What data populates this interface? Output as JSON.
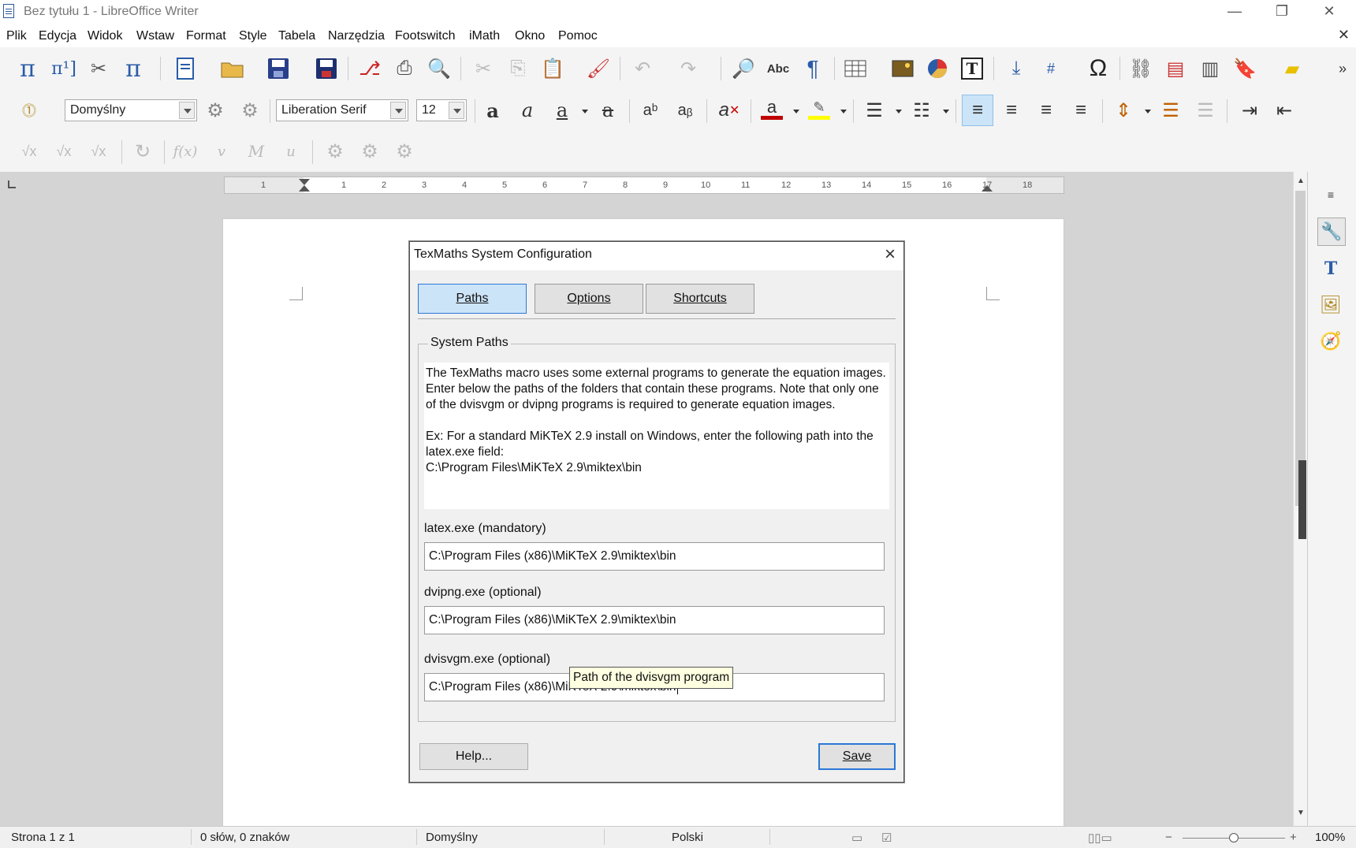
{
  "window": {
    "title": "Bez tytułu 1 - LibreOffice Writer",
    "minimize": "—",
    "restore": "❐",
    "close": "✕",
    "doc_close": "✕"
  },
  "menu": [
    "Plik",
    "Edycja",
    "Widok",
    "Wstaw",
    "Format",
    "Style",
    "Tabela",
    "Narzędzia",
    "Footswitch",
    "iMath",
    "Okno",
    "Pomoc"
  ],
  "formatting": {
    "paragraph_style": "Domyślny",
    "font_name": "Liberation Serif",
    "font_size": "12"
  },
  "ruler": {
    "ticks": [
      "1",
      "1",
      "2",
      "3",
      "4",
      "5",
      "6",
      "7",
      "8",
      "9",
      "10",
      "11",
      "12",
      "13",
      "14",
      "15",
      "16",
      "17",
      "18"
    ]
  },
  "dialog": {
    "title": "TexMaths System Configuration",
    "tabs": [
      {
        "label": "Paths",
        "active": true
      },
      {
        "label": "Options",
        "active": false
      },
      {
        "label": "Shortcuts",
        "active": false
      }
    ],
    "group_title": "System Paths",
    "description": "The TexMaths macro uses some external programs to generate the equation images. Enter below the paths of the folders that contain these programs. Note that only one of the dvisvgm or dvipng programs is required to generate equation images.\n\nEx: For a standard MiKTeX 2.9 install on Windows, enter the following path into the latex.exe field:\nC:\\Program Files\\MiKTeX 2.9\\miktex\\bin",
    "fields": [
      {
        "label": "latex.exe (mandatory)",
        "value": "C:\\Program Files (x86)\\MiKTeX 2.9\\miktex\\bin"
      },
      {
        "label": "dvipng.exe (optional)",
        "value": "C:\\Program Files (x86)\\MiKTeX 2.9\\miktex\\bin"
      },
      {
        "label": "dvisvgm.exe (optional)",
        "value": "C:\\Program Files (x86)\\MiKTeX 2.9\\miktex\\bin"
      }
    ],
    "help_button": "Help...",
    "save_button": "Save",
    "tooltip": "Path of the dvisvgm program"
  },
  "status": {
    "page": "Strona 1 z 1",
    "words": "0 słów, 0 znaków",
    "page_style": "Domyślny",
    "language": "Polski",
    "zoom": "100%"
  },
  "colors": {
    "accent": "#2a78d6",
    "tab_active": "#cce4f7",
    "font_color": "#c00000",
    "highlight": "#ffff00"
  }
}
